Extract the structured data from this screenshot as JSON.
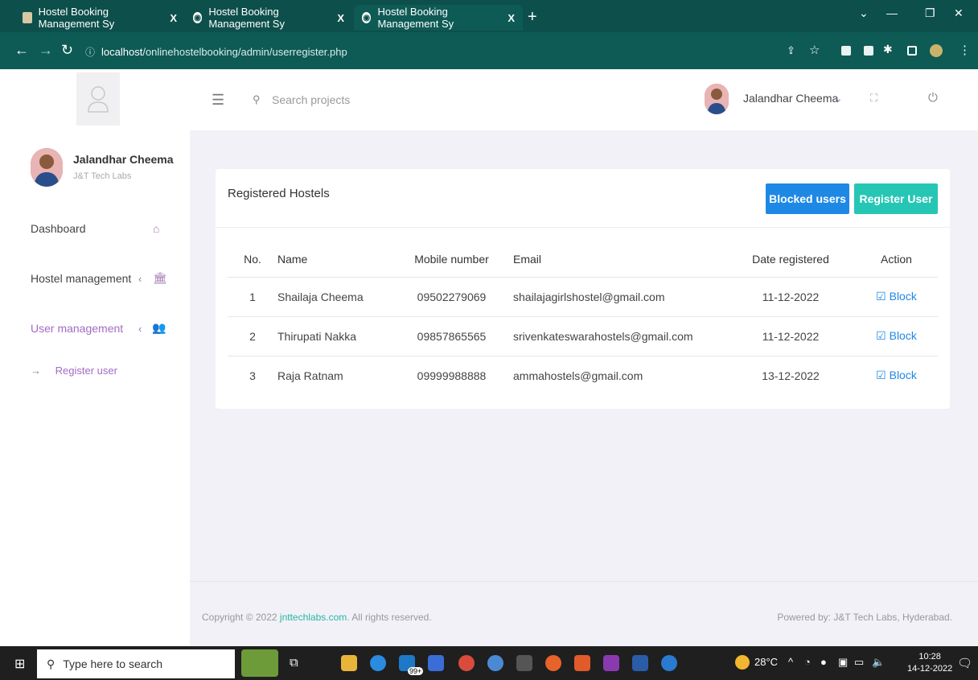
{
  "browser": {
    "tabs": [
      {
        "title": "Hostel Booking Management Sy",
        "close": "X"
      },
      {
        "title": "Hostel Booking Management Sy",
        "close": "X"
      },
      {
        "title": "Hostel Booking Management Sy",
        "close": "X"
      }
    ],
    "new_tab": "+",
    "url_host": "localhost",
    "url_path": "/onlinehostelbooking/admin/userregister.php"
  },
  "sidebar": {
    "profile_name": "Jalandhar Cheema",
    "profile_org": "J&T Tech Labs",
    "items": [
      {
        "label": "Dashboard",
        "icon": "home-icon"
      },
      {
        "label": "Hostel management",
        "icon": "bank-icon"
      },
      {
        "label": "User management",
        "icon": "users-icon"
      }
    ],
    "sub_items": [
      {
        "label": "Register user"
      }
    ]
  },
  "header": {
    "search_placeholder": "Search projects",
    "user_name": "Jalandhar Cheema"
  },
  "card": {
    "title": "Registered Hostels",
    "blocked_button": "Blocked users",
    "register_button": "Register User",
    "columns": [
      "No.",
      "Name",
      "Mobile number",
      "Email",
      "Date registered",
      "Action"
    ],
    "rows": [
      {
        "no": "1",
        "name": "Shailaja Cheema",
        "mobile": "09502279069",
        "email": "shailajagirlshostel@gmail.com",
        "date": "11-12-2022",
        "action": "Block"
      },
      {
        "no": "2",
        "name": "Thirupati Nakka",
        "mobile": "09857865565",
        "email": "srivenkateswarahostels@gmail.com",
        "date": "11-12-2022",
        "action": "Block"
      },
      {
        "no": "3",
        "name": "Raja Ratnam",
        "mobile": "09999988888",
        "email": "ammahostels@gmail.com",
        "date": "13-12-2022",
        "action": "Block"
      }
    ]
  },
  "footer": {
    "copyright_prefix": "Copyright © 2022 ",
    "copyright_link": "jnttechlabs.com",
    "copyright_suffix": ". All rights reserved.",
    "powered": "Powered by: J&T Tech Labs, Hyderabad."
  },
  "taskbar": {
    "search_placeholder": "Type here to search",
    "weather": "28°C",
    "time": "10:28",
    "date": "14-12-2022",
    "badge": "99+"
  },
  "colors": {
    "accent": "#a36bc4",
    "primary": "#1e88e5",
    "teal": "#26c6b4",
    "chrome": "#0d4f4b"
  }
}
